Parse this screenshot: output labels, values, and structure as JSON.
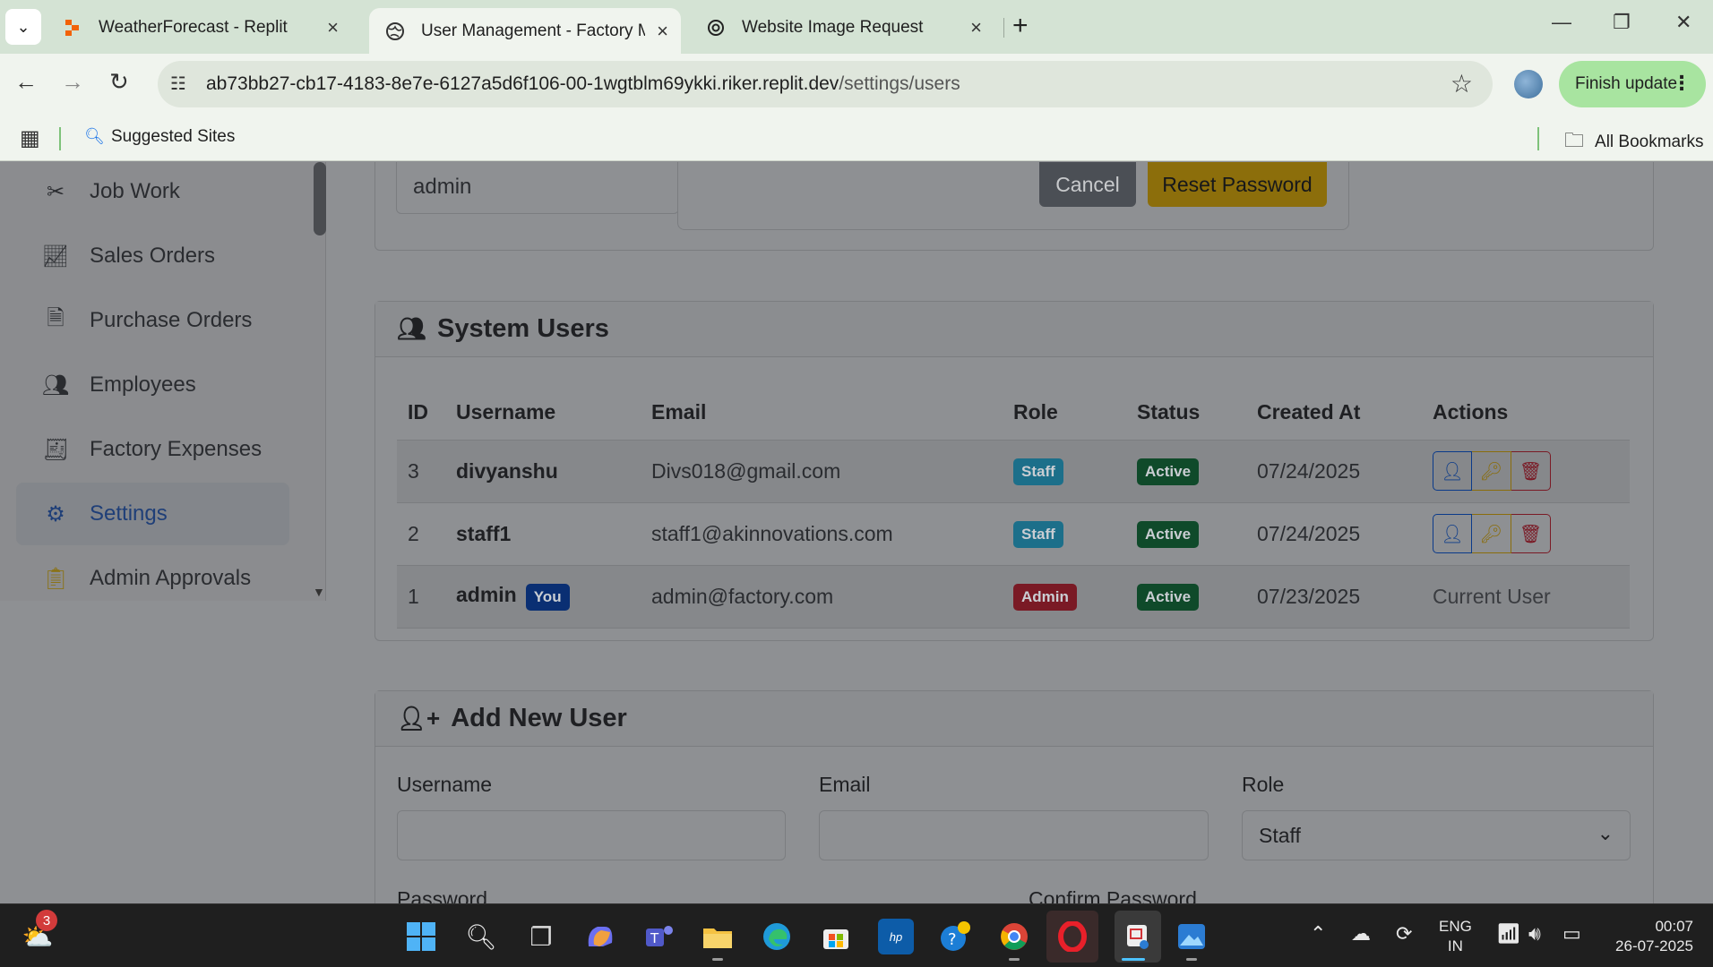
{
  "browser": {
    "tabs": [
      {
        "title": "WeatherForecast - Replit",
        "icon": "replit-icon"
      },
      {
        "title": "User Management - Factory Ma",
        "icon": "globe-icon"
      },
      {
        "title": "Website Image Request",
        "icon": "openai-icon"
      }
    ],
    "url_main": "ab73bb27-cb17-4183-8e7e-6127a5d6f106-00-1wgtblm69ykki.riker.replit.dev",
    "url_path": "/settings/users",
    "finish_update": "Finish update",
    "bookmarks": {
      "suggested": "Suggested Sites",
      "all": "All Bookmarks"
    }
  },
  "sidebar": {
    "items": [
      {
        "label": "Job Work",
        "icon": "tools-icon"
      },
      {
        "label": "Sales Orders",
        "icon": "chart-line-icon"
      },
      {
        "label": "Purchase Orders",
        "icon": "document-icon"
      },
      {
        "label": "Employees",
        "icon": "users-icon"
      },
      {
        "label": "Factory Expenses",
        "icon": "receipt-icon"
      },
      {
        "label": "Settings",
        "icon": "gear-icon",
        "active": true
      },
      {
        "label": "Admin Approvals",
        "icon": "clipboard-check-icon"
      }
    ]
  },
  "reset_modal": {
    "username_value": "admin",
    "cancel": "Cancel",
    "reset": "Reset Password"
  },
  "system_users": {
    "title": "System Users",
    "columns": [
      "ID",
      "Username",
      "Email",
      "Role",
      "Status",
      "Created At",
      "Actions"
    ],
    "rows": [
      {
        "id": "3",
        "username": "divyanshu",
        "email": "Divs018@gmail.com",
        "role": "Staff",
        "status": "Active",
        "created": "07/24/2025"
      },
      {
        "id": "2",
        "username": "staff1",
        "email": "staff1@akinnovations.com",
        "role": "Staff",
        "status": "Active",
        "created": "07/24/2025"
      },
      {
        "id": "1",
        "username": "admin",
        "you_badge": "You",
        "email": "admin@factory.com",
        "role": "Admin",
        "status": "Active",
        "created": "07/23/2025",
        "actions_text": "Current User"
      }
    ]
  },
  "add_user": {
    "title": "Add New User",
    "username_label": "Username",
    "email_label": "Email",
    "role_label": "Role",
    "role_value": "Staff",
    "password_label": "Password",
    "confirm_label": "Confirm Password"
  },
  "taskbar": {
    "weather_badge": "3",
    "lang_line1": "ENG",
    "lang_line2": "IN",
    "time": "00:07",
    "date": "26-07-2025"
  }
}
